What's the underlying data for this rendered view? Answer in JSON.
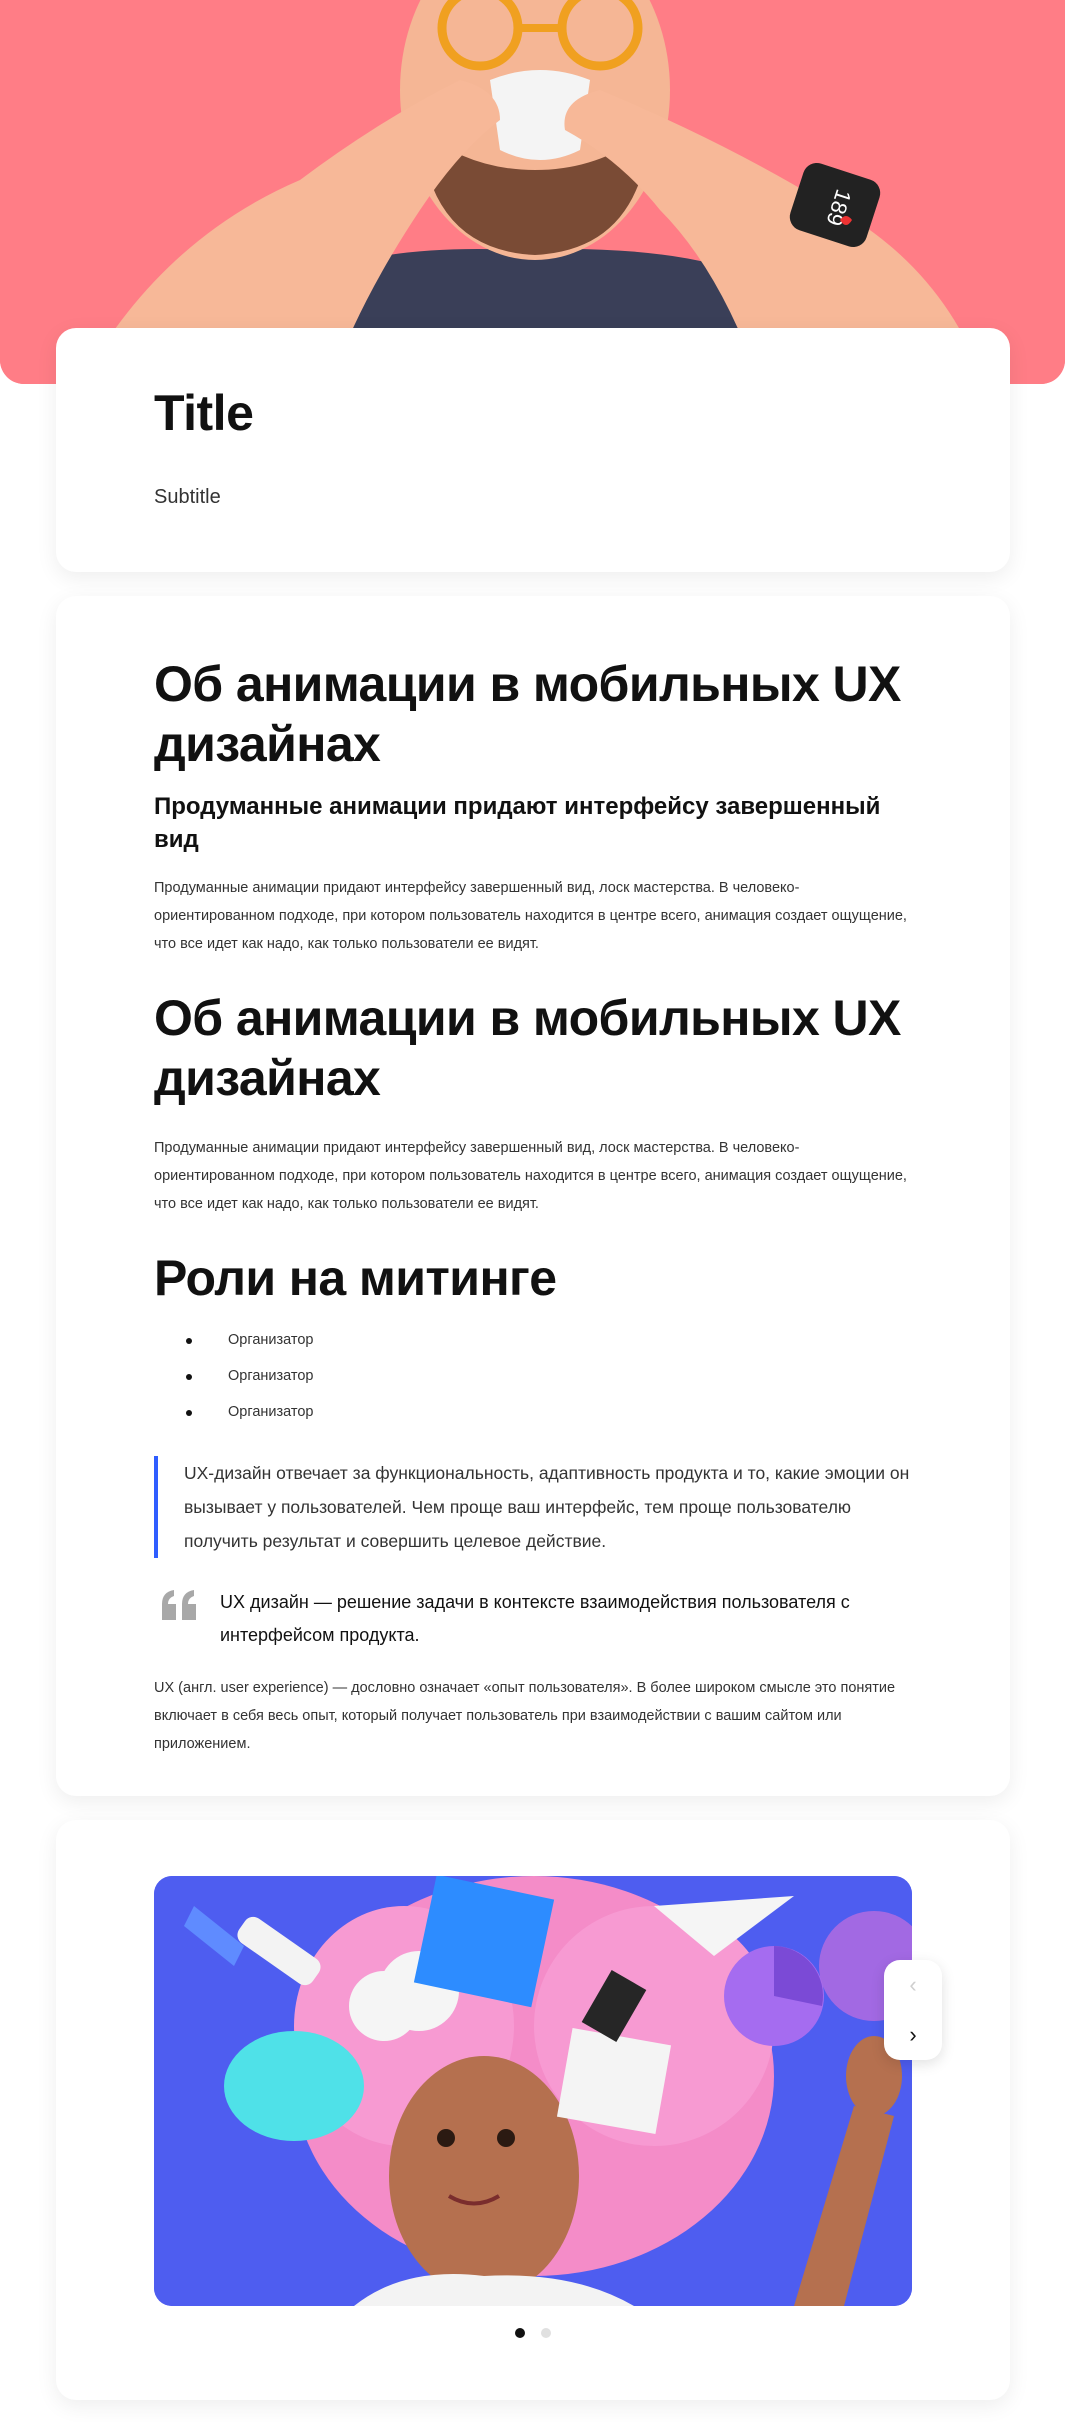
{
  "colors": {
    "hero_bg": "#ff7d86",
    "accent": "#2f5dff",
    "slide_bg": "#4e5df0"
  },
  "hero": {
    "image": "3d-man-drinking-coffee-illustration",
    "watch_number": "189"
  },
  "title_card": {
    "title": "Title",
    "subtitle": "Subtitle"
  },
  "article": {
    "heading1": "Об анимации в мобильных UX дизайнах",
    "subheading": "Продуманные анимации придают интерфейсу завершенный вид",
    "paragraph1": "Продуманные анимации придают интерфейсу завершенный вид, лоск мастерства. В человеко-ориентированном подходе, при котором пользователь находится в центре всего, анимация создает ощущение, что все идет как надо, как только пользователи ее видят.",
    "heading2": "Об анимации в мобильных UX дизайнах",
    "paragraph2": "Продуманные анимации придают интерфейсу завершенный вид, лоск мастерства. В человеко-ориентированном подходе, при котором пользователь находится в центре всего, анимация создает ощущение, что все идет как надо, как только пользователи ее видят.",
    "heading3": "Роли на митинге",
    "roles": [
      "Организатор",
      "Организатор",
      "Организатор"
    ],
    "blockquote": "UX-дизайн отвечает за функциональность, адаптивность продукта и то, какие эмоции он вызывает у пользователей. Чем проще ваш интерфейс, тем проще пользователю получить результат и совершить целевое действие.",
    "pull_quote": "UX дизайн — решение задачи в контексте взаимодействия пользователя с интерфейсом продукта.",
    "paragraph3": "UX (англ. user experience) — дословно означает «опыт пользователя». В более широком смысле это понятие включает в себя весь опыт, который получает пользователь при взаимодействии с вашим сайтом или приложением."
  },
  "slider": {
    "image": "3d-woman-with-creative-objects-illustration",
    "prev_icon": "‹",
    "next_icon": "›",
    "slide_count": 2,
    "active_index": 0
  }
}
